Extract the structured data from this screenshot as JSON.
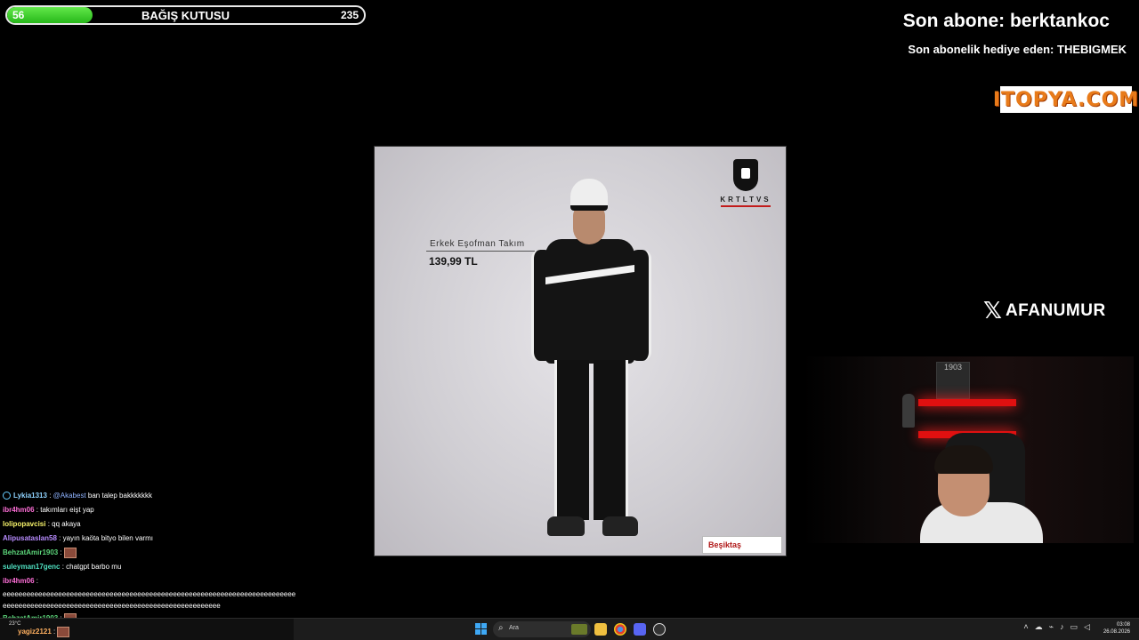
{
  "donation": {
    "current": "56",
    "title": "BAĞIŞ KUTUSU",
    "goal": "235",
    "progress_fraction": 0.24,
    "fill_color": "#3fd22e"
  },
  "stream_labels": {
    "last_subscriber": "Son abone: berktankoc",
    "last_gift": "Son abonelik hediye eden: THEBIGMEK"
  },
  "sponsor": {
    "logo_text": "ITOPYA.COM",
    "color": "#e87b1a"
  },
  "social": {
    "icon": "x-logo-icon",
    "handle": "AFANUMUR"
  },
  "product_image": {
    "brand_text": "KRTLTVS",
    "name": "Erkek Eşofman Takım",
    "price": "139,99 TL",
    "store_tag": "Beşiktaş"
  },
  "webcam": {
    "frame_text": "1903"
  },
  "chat": {
    "messages": [
      {
        "user": "Lykia1313",
        "color": "#8fd3ff",
        "badge": "chat-badge-icon",
        "mention": "@Akabest",
        "text": "ban talep bakkkkkkk"
      },
      {
        "user": "ibr4hm06",
        "color": "#ff6fd8",
        "text": "takımları eişt yap"
      },
      {
        "user": "lolipopavcisi",
        "color": "#f6f26a",
        "text": "qq akaya"
      },
      {
        "user": "Alipusataslan58",
        "color": "#b88cff",
        "text": "yayın kaöta bityo bilen varmı"
      },
      {
        "user": "BehzatAmir1903",
        "color": "#5cd67a",
        "text": "",
        "emote": "emote-icon"
      },
      {
        "user": "suleyman17genc",
        "color": "#4fe0c0",
        "text": "chatgpt barbo mu"
      },
      {
        "user": "ibr4hm06",
        "color": "#ff6fd8",
        "text": "eeeeeeeeeeeeeeeeeeeeeeeeeeeeeeeeeeeeeeeeeeeeeeeeeeeeeeeeeeeeeeeeeeeeeeeeeeeeeeeeeeeeeeeeeeeeeeeeeeeeeeeeeeeeeeeeeeeeeeeeeeeeeeeee"
      },
      {
        "user": "BehzatAmir1903",
        "color": "#5cd67a",
        "text": "",
        "emote": "emote-icon"
      },
      {
        "user": "yagiz2121",
        "color": "#ffb060",
        "text": "",
        "emote": "emote-icon"
      }
    ]
  },
  "taskbar": {
    "weather": "23°C",
    "search_placeholder": "Ara",
    "tray_icons": [
      "chevron-up-icon",
      "cloud-icon",
      "network-icon",
      "mic-icon",
      "display-icon",
      "volume-icon"
    ],
    "time": "03:08",
    "date": "26.08.2026",
    "pinned_icons": [
      "file-explorer-icon",
      "chrome-icon",
      "discord-icon",
      "obs-icon"
    ]
  }
}
